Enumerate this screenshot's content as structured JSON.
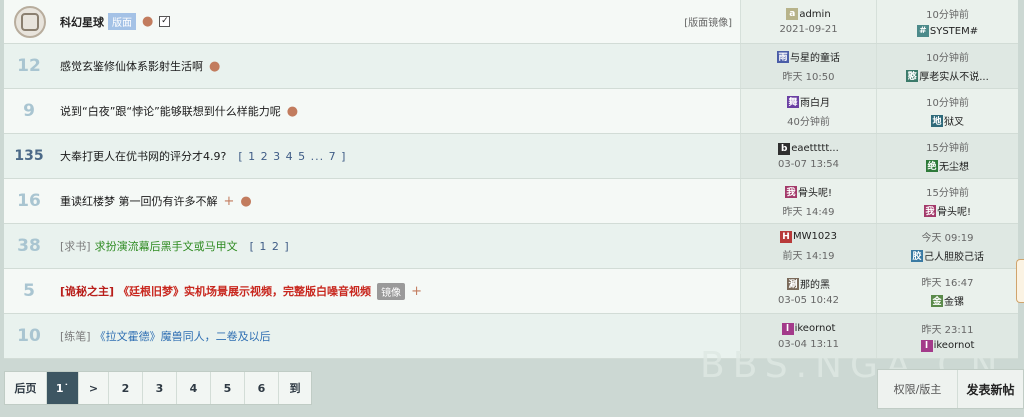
{
  "forum": {
    "name": "科幻星球",
    "board_tag": "版面",
    "mirror_label": "[版面镜像]",
    "author": {
      "name": "admin",
      "avatar_char": "a",
      "avatar_color": "#b7b38a",
      "time": "2021-09-21"
    },
    "last": {
      "time": "10分钟前",
      "name": "SYSTEM#",
      "avatar_char": "#",
      "avatar_color": "#4c8a8a"
    }
  },
  "topics": [
    {
      "replies": "12",
      "prefix": "",
      "title": "感觉玄鉴修仙体系影射生活啊",
      "style": "normal",
      "pages": "",
      "tag": "",
      "marker": "dot",
      "author": {
        "avatar_char": "雨",
        "avatar_color": "#4a5da8",
        "name": "与星的童话",
        "time": "昨天 10:50"
      },
      "last": {
        "time": "10分钟前",
        "avatar_char": "憨",
        "avatar_color": "#3b7a6a",
        "name": "厚老实从不说..."
      }
    },
    {
      "replies": "9",
      "prefix": "",
      "title": "说到“白夜”跟“悖论”能够联想到什么样能力呢",
      "style": "normal",
      "pages": "",
      "tag": "",
      "marker": "dot",
      "author": {
        "avatar_char": "舞",
        "avatar_color": "#6a3fa3",
        "name": "雨白月",
        "time": "40分钟前"
      },
      "last": {
        "time": "10分钟前",
        "avatar_char": "地",
        "avatar_color": "#2e6a7a",
        "name": "狱叉"
      }
    },
    {
      "replies": "135",
      "prefix": "",
      "title": "大奉打更人在优书网的评分才4.9?",
      "style": "normal",
      "pages": "[ 1 2 3 4 5 ... 7 ]",
      "tag": "",
      "marker": "dot",
      "author": {
        "avatar_char": "b",
        "avatar_color": "#2f2f2f",
        "name": "eaettttt...",
        "time": "03-07 13:54"
      },
      "last": {
        "time": "15分钟前",
        "avatar_char": "绝",
        "avatar_color": "#2e7a3a",
        "name": "无尘想"
      }
    },
    {
      "replies": "16",
      "prefix": "",
      "title": "重读红楼梦 第一回仍有许多不解",
      "style": "normal",
      "pages": "",
      "tag": "",
      "marker": "plusdot",
      "author": {
        "avatar_char": "我",
        "avatar_color": "#a33a6a",
        "name": "骨头呢!",
        "time": "昨天 14:49"
      },
      "last": {
        "time": "15分钟前",
        "avatar_char": "我",
        "avatar_color": "#a33a6a",
        "name": "骨头呢!"
      }
    },
    {
      "replies": "38",
      "prefix": "[求书]",
      "title": "求扮演流幕后黑手文或马甲文",
      "style": "green",
      "pages": "[ 1 2 ]",
      "tag": "",
      "marker": "",
      "author": {
        "avatar_char": "H",
        "avatar_color": "#b83a3a",
        "name": "MW1023",
        "time": "前天 14:19"
      },
      "last": {
        "time": "今天 09:19",
        "avatar_char": "胶",
        "avatar_color": "#3a7aa3",
        "name": "己人胆胶己话"
      }
    },
    {
      "replies": "5",
      "prefix": "[诡秘之主]",
      "title": "《廷根旧梦》实机场景展示视频，完整版白噪音视频",
      "style": "red",
      "pages": "",
      "tag": "镜像",
      "marker": "plus",
      "author": {
        "avatar_char": "涮",
        "avatar_color": "#7a6a5a",
        "name": "那的黑",
        "time": "03-05 10:42"
      },
      "last": {
        "time": "昨天 16:47",
        "avatar_char": "金",
        "avatar_color": "#5a8a4a",
        "name": "金镙"
      }
    },
    {
      "replies": "10",
      "prefix": "[练笔]",
      "title": "《拉文霍德》魔兽同人，二卷及以后",
      "style": "blue",
      "pages": "",
      "tag": "",
      "marker": "",
      "author": {
        "avatar_char": "l",
        "avatar_color": "#a33a8a",
        "name": "ikeornot",
        "time": "03-04 13:11"
      },
      "last": {
        "time": "昨天 23:11",
        "avatar_char": "l",
        "avatar_color": "#a33a8a",
        "name": "ikeornot"
      }
    }
  ],
  "pager": {
    "first": "后页",
    "current": "1˙",
    "next": ">",
    "pages": [
      "2",
      "3",
      "4",
      "5",
      "6"
    ],
    "goto": "到"
  },
  "actions": {
    "perm": "权限/版主",
    "post": "发表新帖"
  },
  "watermark": "BBS.NGA.CN"
}
